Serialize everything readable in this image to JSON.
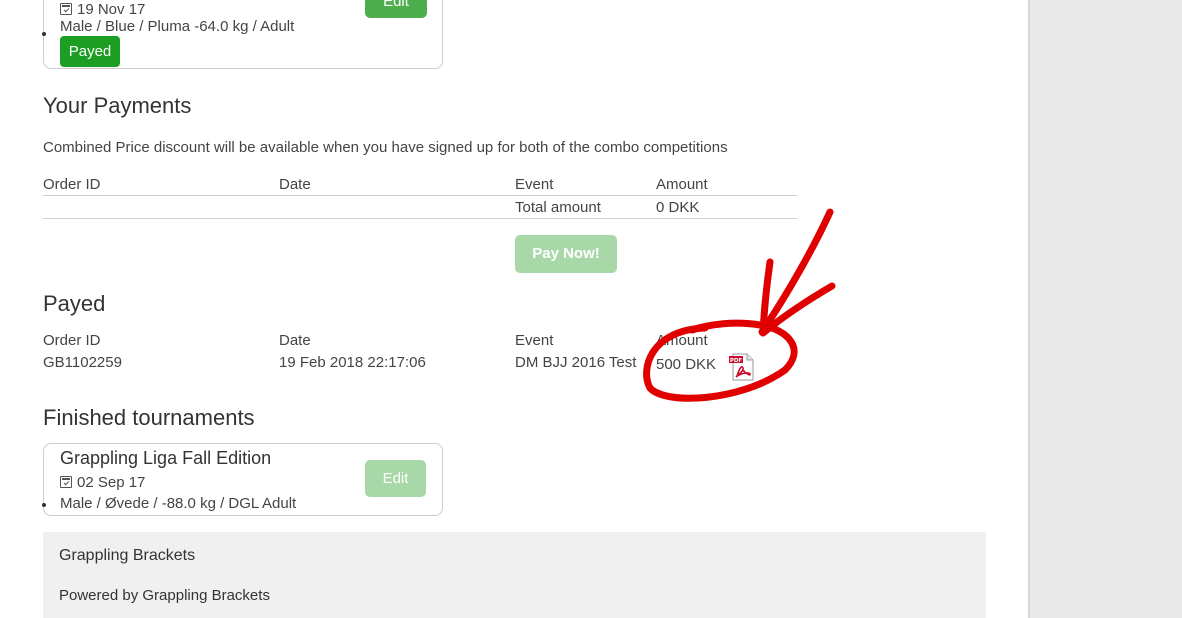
{
  "top_card": {
    "date": "19 Nov 17",
    "details": "Male / Blue / Pluma -64.0 kg / Adult",
    "status": "Payed",
    "edit_label": "Edit"
  },
  "payments": {
    "heading": "Your Payments",
    "note": "Combined Price discount will be available when you have signed up for both of the combo competitions",
    "columns": {
      "order_id": "Order ID",
      "date": "Date",
      "event": "Event",
      "amount": "Amount"
    },
    "total_label": "Total amount",
    "total_value": "0 DKK",
    "pay_button": "Pay Now!"
  },
  "payed": {
    "heading": "Payed",
    "columns": {
      "order_id": "Order ID",
      "date": "Date",
      "event": "Event",
      "amount": "Amount"
    },
    "row": {
      "order_id": "GB1102259",
      "date": "19 Feb 2018 22:17:06",
      "event": "DM BJJ 2016 Test",
      "amount": "500 DKK",
      "icon": "pdf-icon"
    }
  },
  "finished": {
    "heading": "Finished tournaments",
    "card": {
      "title": "Grappling Liga Fall Edition",
      "date": "02 Sep 17",
      "details": "Male / Øvede / -88.0 kg / DGL Adult",
      "edit_label": "Edit"
    }
  },
  "footer": {
    "brand": "Grappling Brackets",
    "powered": "Powered by Grappling Brackets"
  },
  "colors": {
    "payed_green": "#1b9e22",
    "button_green_disabled": "#a8d8a8",
    "annotation_red": "#e00000",
    "gutter": "#e9e9e9"
  }
}
